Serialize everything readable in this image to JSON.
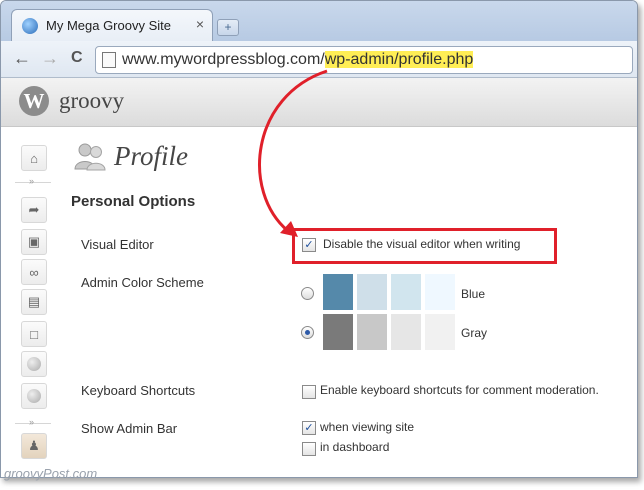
{
  "browser": {
    "tab_title": "My Mega Groovy Site",
    "tab_close": "×",
    "new_tab": "+",
    "back": "←",
    "forward": "→",
    "reload": "C",
    "url_base": "www.mywordpressblog.com/",
    "url_path": "wp-admin/profile.php"
  },
  "header": {
    "logo": "W",
    "site_name": "groovy"
  },
  "page": {
    "title": "Profile",
    "section": "Personal Options",
    "visual_editor": {
      "label": "Visual Editor",
      "option": "Disable the visual editor when writing",
      "checked": true
    },
    "color_scheme": {
      "label": "Admin Color Scheme",
      "options": [
        {
          "name": "Blue",
          "selected": false,
          "colors": [
            "#5589aa",
            "#cfdfe9",
            "#d1e5ee",
            "#eff8ff"
          ]
        },
        {
          "name": "Gray",
          "selected": true,
          "colors": [
            "#7a7a7a",
            "#c8c8c8",
            "#e6e6e6",
            "#f1f1f1"
          ]
        }
      ]
    },
    "keyboard_shortcuts": {
      "label": "Keyboard Shortcuts",
      "option": "Enable keyboard shortcuts for comment moderation.",
      "checked": false
    },
    "admin_bar": {
      "label": "Show Admin Bar",
      "option_site": "when viewing site",
      "site_checked": true,
      "option_dashboard": "in dashboard",
      "dashboard_checked": false
    }
  },
  "check_mark": "✓",
  "watermark": "groovyPost.com",
  "colors": {
    "highlight": "#ffee55",
    "annotation_red": "#e0202a"
  }
}
